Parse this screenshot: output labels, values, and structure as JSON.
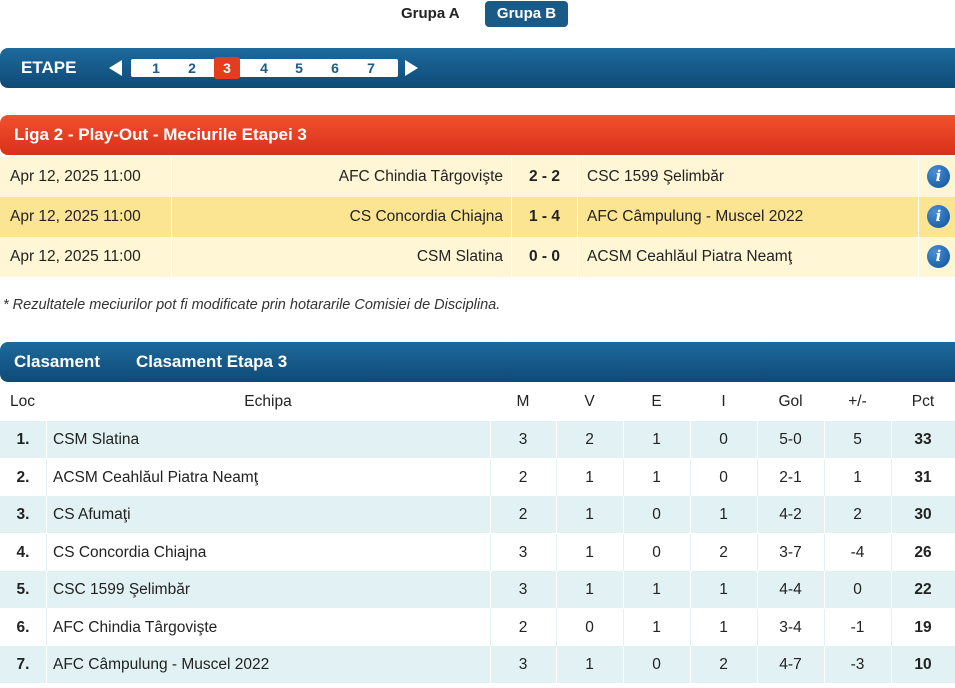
{
  "groups": {
    "items": [
      "Grupa A",
      "Grupa B"
    ],
    "active": "Grupa B"
  },
  "etape": {
    "title": "ETAPE",
    "numbers": [
      "1",
      "2",
      "3",
      "4",
      "5",
      "6",
      "7"
    ],
    "active": "3"
  },
  "matches": {
    "title": "Liga 2 - Play-Out - Meciurile Etapei 3",
    "rows": [
      {
        "date": "Apr 12, 2025 11:00",
        "home": "AFC Chindia Târgovişte",
        "score": "2 - 2",
        "away": "CSC 1599 Şelimbăr"
      },
      {
        "date": "Apr 12, 2025 11:00",
        "home": "CS Concordia Chiajna",
        "score": "1 - 4",
        "away": "AFC Câmpulung - Muscel 2022"
      },
      {
        "date": "Apr 12, 2025 11:00",
        "home": "CSM Slatina",
        "score": "0 - 0",
        "away": "ACSM Ceahlăul Piatra Neamţ"
      }
    ],
    "info_glyph": "i",
    "disclaimer": "* Rezultatele meciurilor pot fi modificate prin hotararile Comisiei de Disciplina."
  },
  "standings": {
    "tabs": [
      "Clasament",
      "Clasament Etapa 3"
    ],
    "columns": {
      "loc": "Loc",
      "team": "Echipa",
      "m": "M",
      "v": "V",
      "e": "E",
      "i": "I",
      "gol": "Gol",
      "pm": "+/-",
      "pct": "Pct"
    },
    "rows": [
      {
        "loc": "1.",
        "team": "CSM Slatina",
        "m": "3",
        "v": "2",
        "e": "1",
        "i": "0",
        "gol": "5-0",
        "pm": "5",
        "pct": "33"
      },
      {
        "loc": "2.",
        "team": "ACSM Ceahlăul Piatra Neamţ",
        "m": "2",
        "v": "1",
        "e": "1",
        "i": "0",
        "gol": "2-1",
        "pm": "1",
        "pct": "31"
      },
      {
        "loc": "3.",
        "team": "CS Afumaţi",
        "m": "2",
        "v": "1",
        "e": "0",
        "i": "1",
        "gol": "4-2",
        "pm": "2",
        "pct": "30"
      },
      {
        "loc": "4.",
        "team": "CS Concordia Chiajna",
        "m": "3",
        "v": "1",
        "e": "0",
        "i": "2",
        "gol": "3-7",
        "pm": "-4",
        "pct": "26"
      },
      {
        "loc": "5.",
        "team": "CSC 1599 Şelimbăr",
        "m": "3",
        "v": "1",
        "e": "1",
        "i": "1",
        "gol": "4-4",
        "pm": "0",
        "pct": "22"
      },
      {
        "loc": "6.",
        "team": "AFC Chindia Târgovişte",
        "m": "2",
        "v": "0",
        "e": "1",
        "i": "1",
        "gol": "3-4",
        "pm": "-1",
        "pct": "19"
      },
      {
        "loc": "7.",
        "team": "AFC Câmpulung - Muscel 2022",
        "m": "3",
        "v": "1",
        "e": "0",
        "i": "2",
        "gol": "4-7",
        "pm": "-3",
        "pct": "10"
      }
    ]
  },
  "colors": {
    "blue_bar": "#155d8e",
    "red_bar": "#e6401f",
    "active_tab": "#1a5a87",
    "row_light_yellow": "#fff6d6",
    "row_dark_yellow": "#fbe592",
    "row_teal": "#e2f1f3"
  }
}
